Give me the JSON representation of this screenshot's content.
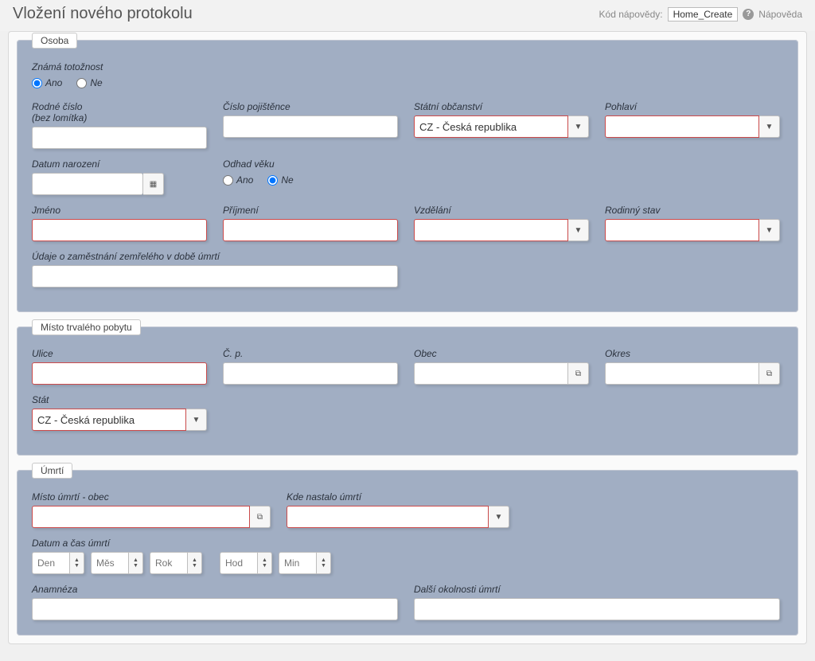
{
  "header": {
    "title": "Vložení nového protokolu",
    "help_label": "Kód nápovědy:",
    "help_code": "Home_Create",
    "help_link": "Nápověda"
  },
  "section_osoba": {
    "legend": "Osoba",
    "znama_totoznost": {
      "label": "Známá totožnost",
      "ano": "Ano",
      "ne": "Ne",
      "value": "ano"
    },
    "rodne_cislo": {
      "label": "Rodné číslo\n(bez lomítka)"
    },
    "cislo_pojistence": {
      "label": "Číslo pojištěnce"
    },
    "statni_obcanstvi": {
      "label": "Státní občanství",
      "value": "CZ - Česká republika"
    },
    "pohlavi": {
      "label": "Pohlaví",
      "value": ""
    },
    "datum_narozeni": {
      "label": "Datum narození"
    },
    "odhad_veku": {
      "label": "Odhad věku",
      "ano": "Ano",
      "ne": "Ne",
      "value": "ne"
    },
    "jmeno": {
      "label": "Jméno"
    },
    "prijmeni": {
      "label": "Příjmení"
    },
    "vzdelani": {
      "label": "Vzdělání",
      "value": ""
    },
    "rodinny_stav": {
      "label": "Rodinný stav",
      "value": ""
    },
    "zamestnani": {
      "label": "Údaje o zaměstnání zemřelého v době úmrtí"
    }
  },
  "section_pobyt": {
    "legend": "Místo trvalého pobytu",
    "ulice": {
      "label": "Ulice"
    },
    "cp": {
      "label": "Č. p."
    },
    "obec": {
      "label": "Obec"
    },
    "okres": {
      "label": "Okres"
    },
    "stat": {
      "label": "Stát",
      "value": "CZ - Česká republika"
    }
  },
  "section_umrti": {
    "legend": "Úmrtí",
    "misto_obec": {
      "label": "Místo úmrtí - obec"
    },
    "kde_nastalo": {
      "label": "Kde nastalo úmrtí",
      "value": ""
    },
    "datum_cas": {
      "label": "Datum a čas úmrtí"
    },
    "spinners": {
      "den": "Den",
      "mes": "Měs",
      "rok": "Rok",
      "hod": "Hod",
      "min": "Min"
    },
    "anamneza": {
      "label": "Anamnéza"
    },
    "dalsi_okolnosti": {
      "label": "Další okolnosti úmrtí"
    }
  }
}
